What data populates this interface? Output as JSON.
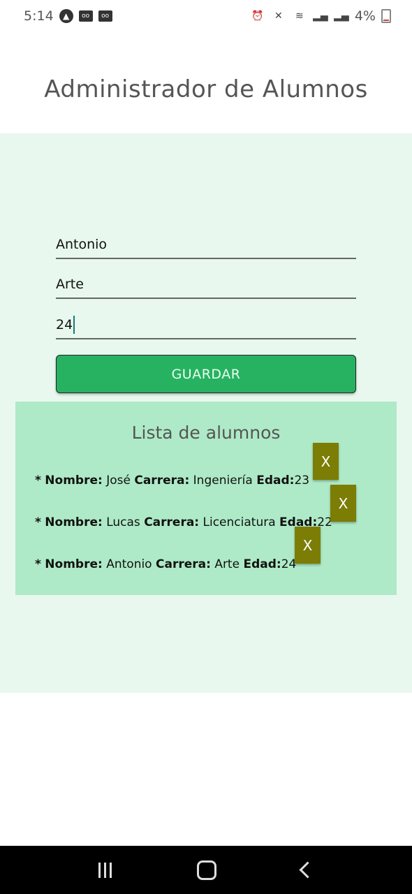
{
  "status_bar": {
    "time": "5:14",
    "battery": "4%",
    "icons_left": [
      "app-icon",
      "voicemail-icon",
      "voicemail-icon"
    ],
    "icons_right": [
      "alarm-icon",
      "mute-icon",
      "wifi-icon",
      "signal-icon",
      "signal-icon",
      "battery-icon"
    ]
  },
  "app": {
    "title": "Administrador de Alumnos"
  },
  "form": {
    "name_value": "Antonio",
    "career_value": "Arte",
    "age_value": "24",
    "save_label": "GUARDAR"
  },
  "list": {
    "title": "Lista de alumnos",
    "bullet": "*",
    "name_label": "Nombre:",
    "career_label": "Carrera:",
    "age_label": "Edad:",
    "delete_label": "X",
    "items": [
      {
        "name": "José",
        "career": "Ingeniería",
        "age": "23"
      },
      {
        "name": "Lucas",
        "career": "Licenciatura",
        "age": "22"
      },
      {
        "name": "Antonio",
        "career": "Arte",
        "age": "24"
      }
    ]
  },
  "colors": {
    "main_bg": "#e8f8ee",
    "list_bg": "#aeeac7",
    "save_button": "#27b262",
    "delete_button": "#7c7d05"
  }
}
